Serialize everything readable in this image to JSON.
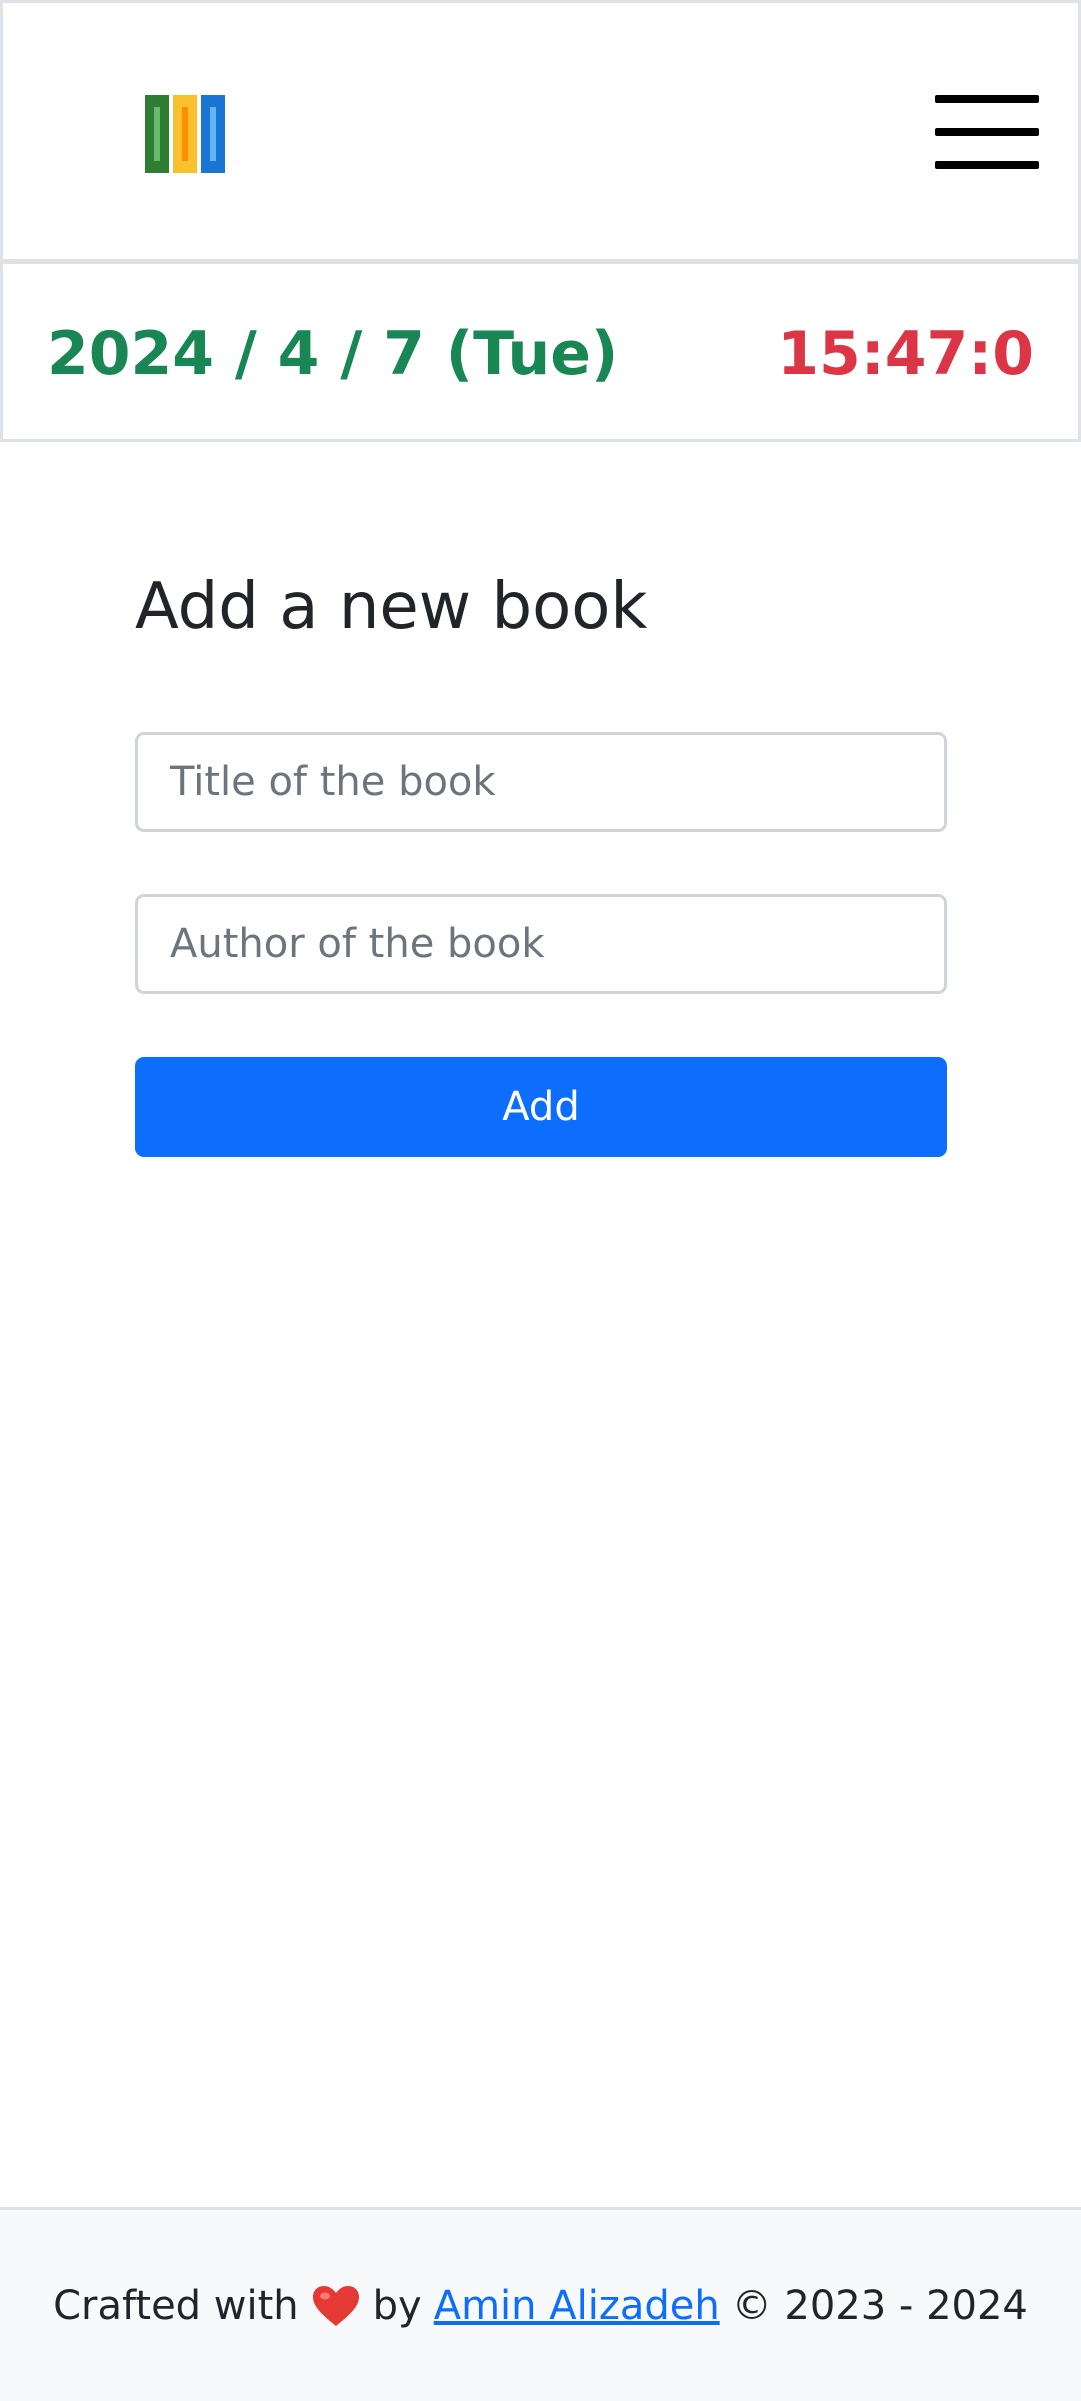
{
  "header": {
    "logo_icon": "books-icon",
    "menu_icon": "hamburger-icon",
    "colors": {
      "book1": "#2e7d32",
      "book2": "#fbc02d",
      "book3": "#1976d2"
    }
  },
  "datebar": {
    "date": "2024 / 4 / 7 (Tue)",
    "time": "15:47:0",
    "date_color": "#198754",
    "time_color": "#dc3545"
  },
  "form": {
    "title": "Add a new book",
    "title_placeholder": "Title of the book",
    "author_placeholder": "Author of the book",
    "title_value": "",
    "author_value": "",
    "add_label": "Add",
    "button_color": "#0d6efd"
  },
  "footer": {
    "prefix": "Crafted with",
    "heart_icon": "heart-icon",
    "by": "by",
    "author_link": "Amin Alizadeh",
    "copyright": "© 2023 - 2024"
  }
}
